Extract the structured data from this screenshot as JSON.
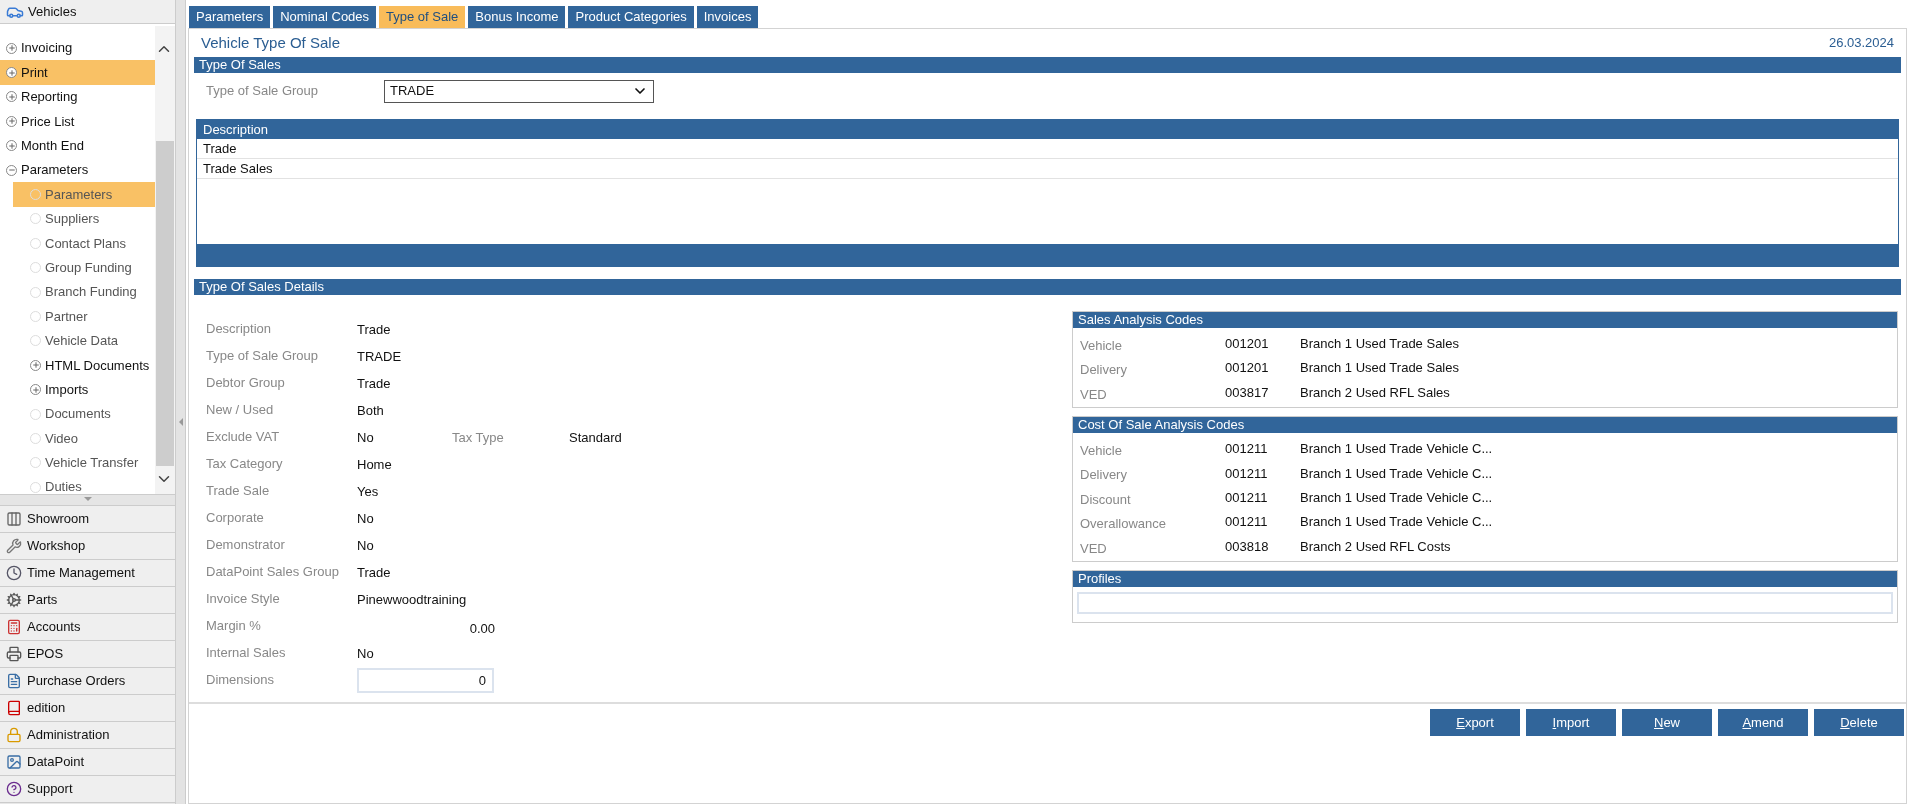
{
  "sidebar": {
    "title": "Vehicles",
    "tree": [
      {
        "label": "Invoicing",
        "kind": "group",
        "expanded": false,
        "selected": false
      },
      {
        "label": "Print",
        "kind": "group",
        "expanded": false,
        "selected": true
      },
      {
        "label": "Reporting",
        "kind": "group",
        "expanded": false,
        "selected": false
      },
      {
        "label": "Price List",
        "kind": "group",
        "expanded": false,
        "selected": false
      },
      {
        "label": "Month End",
        "kind": "group",
        "expanded": false,
        "selected": false
      },
      {
        "label": "Parameters",
        "kind": "group",
        "expanded": true,
        "selected": false,
        "children": [
          {
            "label": "Parameters",
            "kind": "leaf",
            "selected": true
          },
          {
            "label": "Suppliers",
            "kind": "leaf",
            "selected": false
          },
          {
            "label": "Contact Plans",
            "kind": "leaf",
            "selected": false
          },
          {
            "label": "Group Funding",
            "kind": "leaf",
            "selected": false
          },
          {
            "label": "Branch Funding",
            "kind": "leaf",
            "selected": false
          },
          {
            "label": "Partner",
            "kind": "leaf",
            "selected": false
          },
          {
            "label": "Vehicle Data",
            "kind": "leaf",
            "selected": false
          },
          {
            "label": "HTML Documents",
            "kind": "group",
            "expanded": false,
            "selected": false
          },
          {
            "label": "Imports",
            "kind": "group",
            "expanded": false,
            "selected": false
          },
          {
            "label": "Documents",
            "kind": "leaf",
            "selected": false
          },
          {
            "label": "Video",
            "kind": "leaf",
            "selected": false
          },
          {
            "label": "Vehicle Transfer",
            "kind": "leaf",
            "selected": false
          },
          {
            "label": "Duties",
            "kind": "leaf",
            "selected": false
          }
        ]
      }
    ],
    "modules": [
      "Showroom",
      "Workshop",
      "Time Management",
      "Parts",
      "Accounts",
      "EPOS",
      "Purchase Orders",
      "edition",
      "Administration",
      "DataPoint",
      "Support"
    ]
  },
  "tabs": [
    {
      "label": "Parameters",
      "selected": false
    },
    {
      "label": "Nominal Codes",
      "selected": false
    },
    {
      "label": "Type of Sale",
      "selected": true
    },
    {
      "label": "Bonus Income",
      "selected": false
    },
    {
      "label": "Product Categories",
      "selected": false
    },
    {
      "label": "Invoices",
      "selected": false
    }
  ],
  "page": {
    "title": "Vehicle Type Of Sale",
    "date": "26.03.2024"
  },
  "type_of_sales": {
    "heading": "Type Of Sales",
    "group_label": "Type of Sale Group",
    "group_value": "TRADE",
    "table": {
      "columns": [
        "Description"
      ],
      "rows": [
        "Trade",
        "Trade Sales"
      ]
    }
  },
  "details": {
    "heading": "Type Of Sales Details",
    "fields": [
      {
        "label": "Description",
        "value": "Trade",
        "kind": "text"
      },
      {
        "label": "Type of Sale Group",
        "value": "TRADE",
        "kind": "text"
      },
      {
        "label": "Debtor Group",
        "value": "Trade",
        "kind": "text"
      },
      {
        "label": "New / Used",
        "value": "Both",
        "kind": "text"
      },
      {
        "label": "Exclude VAT",
        "value": "No",
        "kind": "pair",
        "label_2": "Tax Type",
        "value_2": "Standard"
      },
      {
        "label": "Tax Category",
        "value": "Home",
        "kind": "text"
      },
      {
        "label": "Trade Sale",
        "value": "Yes",
        "kind": "text"
      },
      {
        "label": "Corporate",
        "value": "No",
        "kind": "text"
      },
      {
        "label": "Demonstrator",
        "value": "No",
        "kind": "text"
      },
      {
        "label": "DataPoint Sales Group",
        "value": "Trade",
        "kind": "text"
      },
      {
        "label": "Invoice Style",
        "value": "Pinewwoodtraining",
        "kind": "text"
      },
      {
        "label": "Margin %",
        "value": "0.00",
        "kind": "number"
      },
      {
        "label": "Internal Sales",
        "value": "No",
        "kind": "text"
      },
      {
        "label": "Dimensions",
        "value": "0",
        "kind": "input"
      }
    ]
  },
  "sales_analysis_codes": {
    "heading": "Sales Analysis Codes",
    "rows": [
      {
        "label": "Vehicle",
        "code": "001201",
        "description": "Branch 1 Used Trade Sales"
      },
      {
        "label": "Delivery",
        "code": "001201",
        "description": "Branch 1 Used Trade Sales"
      },
      {
        "label": "VED",
        "code": "003817",
        "description": "Branch 2 Used RFL Sales"
      }
    ]
  },
  "cost_of_sale_analysis_codes": {
    "heading": "Cost Of Sale Analysis Codes",
    "rows": [
      {
        "label": "Vehicle",
        "code": "001211",
        "description": "Branch 1 Used Trade Vehicle C..."
      },
      {
        "label": "Delivery",
        "code": "001211",
        "description": "Branch 1 Used Trade Vehicle C..."
      },
      {
        "label": "Discount",
        "code": "001211",
        "description": "Branch 1 Used Trade Vehicle C..."
      },
      {
        "label": "Overallowance",
        "code": "001211",
        "description": "Branch 1 Used Trade Vehicle C..."
      },
      {
        "label": "VED",
        "code": "003818",
        "description": "Branch 2 Used RFL Costs"
      }
    ]
  },
  "profiles": {
    "heading": "Profiles"
  },
  "buttons": [
    "Export",
    "Import",
    "New",
    "Amend",
    "Delete"
  ]
}
